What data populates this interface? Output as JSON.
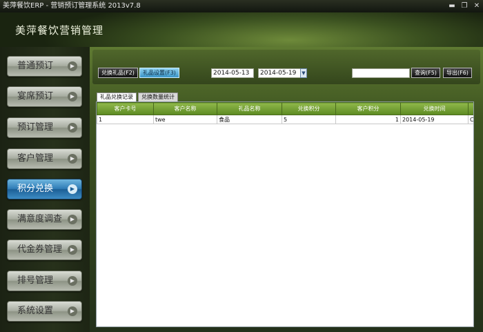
{
  "window": {
    "title": "美萍餐饮ERP - 营销预订管理系统 2013v7.8",
    "controls": [
      "▬",
      "❐",
      "✕"
    ]
  },
  "app": {
    "title": "美萍餐饮营销管理"
  },
  "sidebar": {
    "items": [
      {
        "label": "普通预订",
        "active": false
      },
      {
        "label": "宴席预订",
        "active": false
      },
      {
        "label": "预订管理",
        "active": false
      },
      {
        "label": "客户管理",
        "active": false
      },
      {
        "label": "积分兑换",
        "active": true
      },
      {
        "label": "满意度调查",
        "active": false
      },
      {
        "label": "代金券管理",
        "active": false
      },
      {
        "label": "排号管理",
        "active": false
      },
      {
        "label": "系统设置",
        "active": false
      }
    ]
  },
  "toolbar": {
    "exchange_label": "兑换礼品(F2)",
    "gift_setting_label": "礼品设置(F3)",
    "date_from": "2014-05-13",
    "date_to": "2014-05-19",
    "query_label": "查询(F5)",
    "export_label": "导出(F6)",
    "search_value": ""
  },
  "tabs": [
    {
      "label": "礼品兑换记录",
      "active": true
    },
    {
      "label": "兑换数量统计",
      "active": false
    }
  ],
  "table": {
    "columns": [
      "客户卡号",
      "客户名称",
      "礼品名称",
      "兑换积分",
      "客户积分",
      "兑换时间"
    ],
    "rows": [
      [
        "1",
        "twe",
        "食品",
        "5",
        "1",
        "2014-05-19",
        "Cy"
      ]
    ]
  },
  "colors": {
    "active_blue": "#2f7cb6",
    "header_green": "#5c8a22"
  }
}
